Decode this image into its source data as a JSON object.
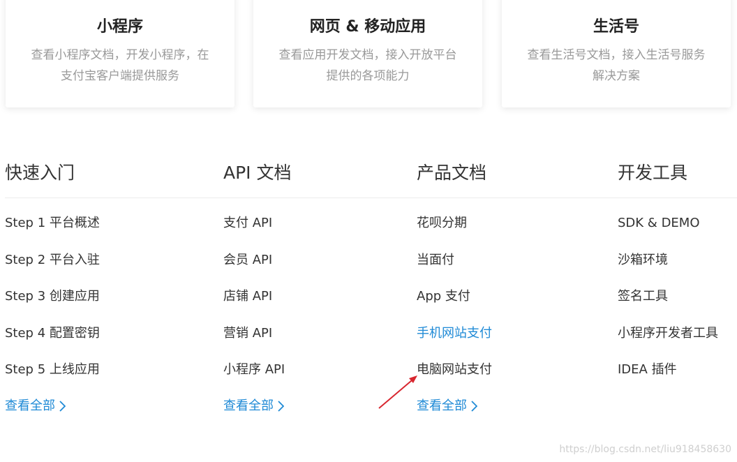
{
  "cards": [
    {
      "title": "小程序",
      "desc": "查看小程序文档，开发小程序，在支付宝客户端提供服务",
      "icon": "mini-program-icon",
      "color": "#1f8ad6"
    },
    {
      "title": "网页 & 移动应用",
      "desc": "查看应用开发文档，接入开放平台提供的各项能力",
      "icon": "web-mobile-icon",
      "color": "#ef6b4d"
    },
    {
      "title": "生活号",
      "desc": "查看生活号文档，接入生活号服务解决方案",
      "icon": "life-account-icon",
      "color": "#13c2d9"
    }
  ],
  "columns": [
    {
      "title": "快速入门",
      "items": [
        "Step 1 平台概述",
        "Step 2 平台入驻",
        "Step 3 创建应用",
        "Step 4 配置密钥",
        "Step 5 上线应用"
      ],
      "more": "查看全部"
    },
    {
      "title": "API 文档",
      "items": [
        "支付 API",
        "会员 API",
        "店铺 API",
        "营销 API",
        "小程序 API"
      ],
      "more": "查看全部"
    },
    {
      "title": "产品文档",
      "items": [
        "花呗分期",
        "当面付",
        "App 支付",
        "手机网站支付",
        "电脑网站支付"
      ],
      "more": "查看全部",
      "active_index": 3
    },
    {
      "title": "开发工具",
      "items": [
        "SDK & DEMO",
        "沙箱环境",
        "签名工具",
        "小程序开发者工具",
        "IDEA 插件"
      ]
    }
  ],
  "annotation": {
    "color": "#d8262f",
    "icon": "red-arrow-annotation"
  },
  "watermark": "https://blog.csdn.net/liu918458630"
}
